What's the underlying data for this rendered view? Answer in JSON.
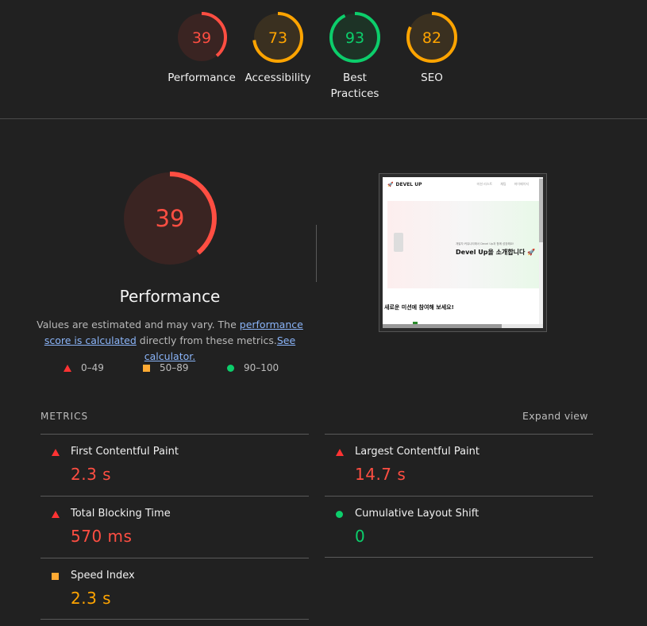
{
  "colors": {
    "fail": "#ff4e42",
    "average": "#ffa400",
    "pass": "#0cce6b",
    "background": "#212121"
  },
  "summary_gauges": [
    {
      "score": "39",
      "label": "Performance",
      "rating": "fail"
    },
    {
      "score": "73",
      "label": "Accessibility",
      "rating": "average"
    },
    {
      "score": "93",
      "label": "Best Practices",
      "rating": "pass"
    },
    {
      "score": "82",
      "label": "SEO",
      "rating": "average"
    }
  ],
  "main": {
    "score": "39",
    "title": "Performance",
    "description_prefix": "Values are estimated and may vary. The ",
    "score_link": "performance score is calculated",
    "description_mid": " directly from these metrics.",
    "calculator_link": "See calculator.",
    "legend": [
      {
        "icon": "triangle-icon",
        "range": "0–49"
      },
      {
        "icon": "square-icon",
        "range": "50–89"
      },
      {
        "icon": "circle-icon",
        "range": "90–100"
      }
    ]
  },
  "thumbnail": {
    "brand": "DEVEL UP",
    "nav": [
      "미션 리스트",
      "채팅",
      "마이페이지"
    ],
    "hero_small": "개발자 커뮤니티에서 Devel Up과 함께 성장해요!",
    "hero_title": "Devel Up을 소개합니다 🚀",
    "mission_heading": "새로운 미션에 참여해 보세요!"
  },
  "metrics": {
    "title": "METRICS",
    "expand_label": "Expand view",
    "items": [
      {
        "label": "First Contentful Paint",
        "value": "2.3 s",
        "rating": "fail"
      },
      {
        "label": "Largest Contentful Paint",
        "value": "14.7 s",
        "rating": "fail"
      },
      {
        "label": "Total Blocking Time",
        "value": "570 ms",
        "rating": "fail"
      },
      {
        "label": "Cumulative Layout Shift",
        "value": "0",
        "rating": "pass"
      },
      {
        "label": "Speed Index",
        "value": "2.3 s",
        "rating": "average"
      }
    ]
  }
}
